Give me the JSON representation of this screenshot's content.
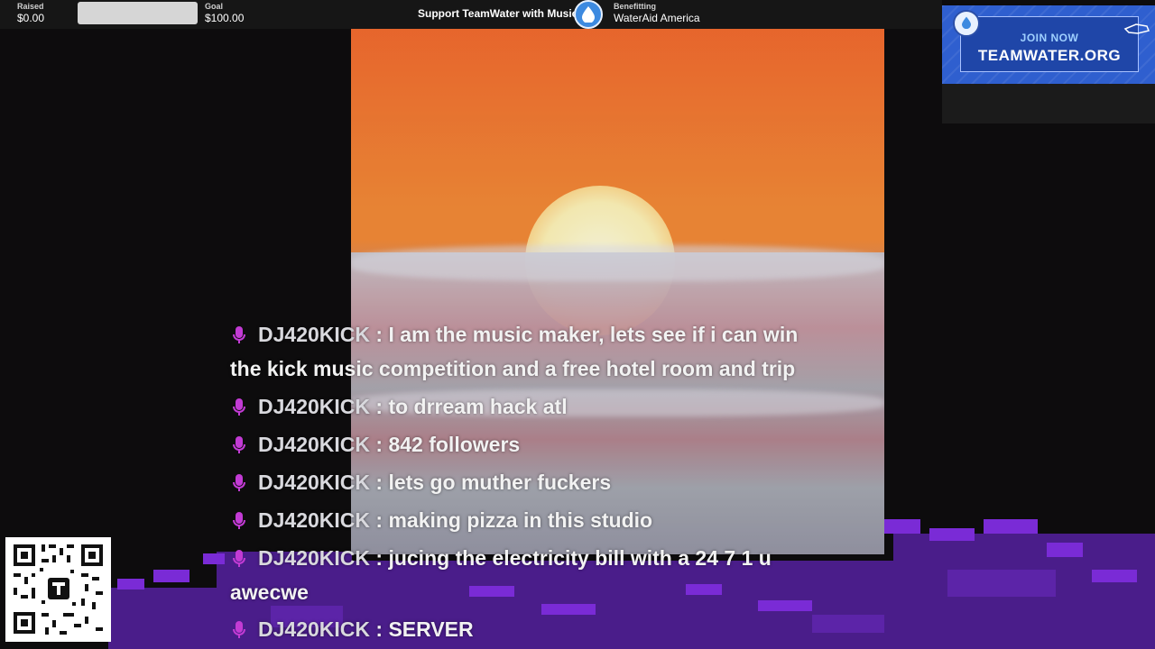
{
  "fundraiser": {
    "raised_label": "Raised",
    "raised_value": "$0.00",
    "goal_label": "Goal",
    "goal_value": "$100.00",
    "progress_fraction": 0,
    "support_text": "Support TeamWater with Music",
    "benefitting_label": "Benefitting",
    "benefitting_value": "WaterAid America"
  },
  "promo": {
    "join_text": "JOIN NOW",
    "site_text": "TEAMWATER.ORG"
  },
  "chat": {
    "messages": [
      {
        "user": "DJ420KICK",
        "sep": " : ",
        "text": "I am the music maker, lets see if i can win the kick music competition and a free hotel room and trip"
      },
      {
        "user": "DJ420KICK",
        "sep": " : ",
        "text": "to drream hack atl"
      },
      {
        "user": "DJ420KICK",
        "sep": " : ",
        "text": "842 followers"
      },
      {
        "user": "DJ420KICK",
        "sep": " : ",
        "text": "lets go muther fuckers"
      },
      {
        "user": "DJ420KICK",
        "sep": " : ",
        "text": "making pizza in this studio"
      },
      {
        "user": "DJ420KICK",
        "sep": " : ",
        "text": "jucing the electricity bill with a 24 7 1 u awecwe"
      },
      {
        "user": "DJ420KICK",
        "sep": " : ",
        "text": "SERVER"
      }
    ]
  },
  "colors": {
    "accent_purple": "#7a2bd6",
    "mic_pink": "#c23bd4",
    "promo_blue": "#2f5fcf"
  },
  "icons": {
    "mic": "microphone-icon",
    "drop": "water-drop-icon",
    "hand": "pointing-hand-icon",
    "qr": "qr-code-icon"
  }
}
